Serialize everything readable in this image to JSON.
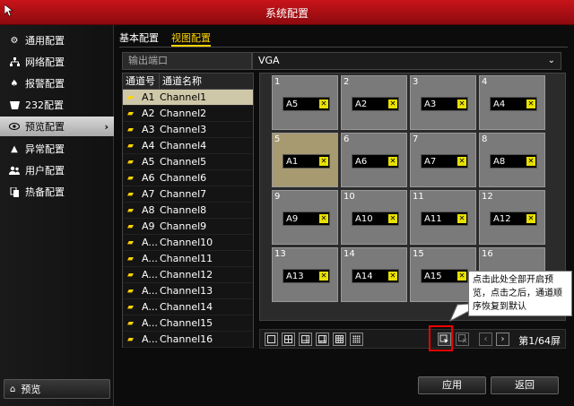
{
  "window": {
    "title": "系统配置"
  },
  "sidebar": {
    "items": [
      {
        "label": "通用配置",
        "icon": "gear-icon"
      },
      {
        "label": "网络配置",
        "icon": "network-icon"
      },
      {
        "label": "报警配置",
        "icon": "alarm-icon"
      },
      {
        "label": "232配置",
        "icon": "serial-icon"
      },
      {
        "label": "预览配置",
        "icon": "eye-icon",
        "active": true
      },
      {
        "label": "异常配置",
        "icon": "warning-icon"
      },
      {
        "label": "用户配置",
        "icon": "user-icon"
      },
      {
        "label": "热备配置",
        "icon": "hotspare-icon"
      }
    ],
    "bottom_label": "预览"
  },
  "tabs": [
    {
      "label": "基本配置"
    },
    {
      "label": "视图配置",
      "active": true
    }
  ],
  "output": {
    "label": "输出端口",
    "value": "VGA"
  },
  "channel_list": {
    "headers": {
      "num": "通道号",
      "name": "通道名称"
    },
    "rows": [
      {
        "num": "A1",
        "name": "Channel1"
      },
      {
        "num": "A2",
        "name": "Channel2"
      },
      {
        "num": "A3",
        "name": "Channel3"
      },
      {
        "num": "A4",
        "name": "Channel4"
      },
      {
        "num": "A5",
        "name": "Channel5"
      },
      {
        "num": "A6",
        "name": "Channel6"
      },
      {
        "num": "A7",
        "name": "Channel7"
      },
      {
        "num": "A8",
        "name": "Channel8"
      },
      {
        "num": "A9",
        "name": "Channel9"
      },
      {
        "num": "A...",
        "name": "Channel10"
      },
      {
        "num": "A...",
        "name": "Channel11"
      },
      {
        "num": "A...",
        "name": "Channel12"
      },
      {
        "num": "A...",
        "name": "Channel13"
      },
      {
        "num": "A...",
        "name": "Channel14"
      },
      {
        "num": "A...",
        "name": "Channel15"
      },
      {
        "num": "A...",
        "name": "Channel16"
      }
    ]
  },
  "preview_grid": {
    "cells": [
      {
        "index": "1",
        "label": "A5"
      },
      {
        "index": "2",
        "label": "A2"
      },
      {
        "index": "3",
        "label": "A3"
      },
      {
        "index": "4",
        "label": "A4"
      },
      {
        "index": "5",
        "label": "A1"
      },
      {
        "index": "6",
        "label": "A6"
      },
      {
        "index": "7",
        "label": "A7"
      },
      {
        "index": "8",
        "label": "A8"
      },
      {
        "index": "9",
        "label": "A9"
      },
      {
        "index": "10",
        "label": "A10"
      },
      {
        "index": "11",
        "label": "A11"
      },
      {
        "index": "12",
        "label": "A12"
      },
      {
        "index": "13",
        "label": "A13"
      },
      {
        "index": "14",
        "label": "A14"
      },
      {
        "index": "15",
        "label": "A15"
      },
      {
        "index": "16",
        "label": ""
      }
    ]
  },
  "pagination": {
    "page_text": "第1/64屏"
  },
  "callout": {
    "text": "点击此处全部开启预览，点击之后，通道顺序恢复到默认"
  },
  "buttons": {
    "apply": "应用",
    "back": "返回"
  },
  "colors": {
    "titlebar": "#b01016",
    "accent": "#ffd400",
    "highlight_cell": "#a89a70"
  }
}
